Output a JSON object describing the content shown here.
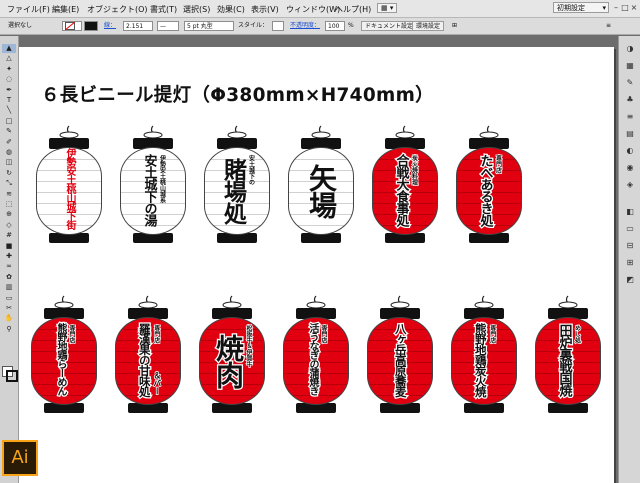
{
  "menubar": {
    "items": [
      "ファイル(F)",
      "編集(E)",
      "オブジェクト(O)",
      "書式(T)",
      "選択(S)",
      "効果(C)",
      "表示(V)",
      "ウィンドウ(W)",
      "ヘルプ(H)"
    ],
    "workspace": "初期設定"
  },
  "control_bar": {
    "selection": "選択なし",
    "stroke_label": "線：",
    "stroke_value": "2.151",
    "brush": "5 pt 丸型",
    "style_label": "スタイル：",
    "opacity_label": "不透明度：",
    "opacity_value": "100",
    "opacity_unit": "%",
    "document_setup": "ドキュメント設定",
    "preferences": "環境設定"
  },
  "tools": [
    "selection-tool",
    "direct-selection-tool",
    "magic-wand-tool",
    "lasso-tool",
    "pen-tool",
    "type-tool",
    "line-tool",
    "rectangle-tool",
    "paintbrush-tool",
    "pencil-tool",
    "blob-brush-tool",
    "eraser-tool",
    "rotate-tool",
    "scale-tool",
    "width-tool",
    "free-transform-tool",
    "shape-builder-tool",
    "perspective-tool",
    "mesh-tool",
    "gradient-tool",
    "eyedropper-tool",
    "blend-tool",
    "symbol-sprayer-tool",
    "graph-tool",
    "artboard-tool",
    "slice-tool",
    "hand-tool",
    "zoom-tool"
  ],
  "dock": [
    "color-icon",
    "swatches-icon",
    "brushes-icon",
    "symbols-icon",
    "stroke-icon",
    "gradient-icon",
    "transparency-icon",
    "appearance-icon",
    "graphic-styles-icon",
    "layers-icon",
    "artboards-icon",
    "align-icon",
    "transform-icon",
    "pathfinder-icon"
  ],
  "artboard": {
    "title": "６長ビニール提灯（Φ380mm×H740mm）",
    "lanterns_row1": [
      {
        "color": "white",
        "main": "伊勢安土桃山城下街",
        "main_color": "#e0000f",
        "sub": ""
      },
      {
        "color": "white",
        "main": "安土城下の湯",
        "sub": "伊勢安土桃山城系"
      },
      {
        "color": "white",
        "main": "賭場処",
        "sub": "安土城下の"
      },
      {
        "color": "white",
        "main": "矢場",
        "sub": ""
      },
      {
        "color": "red",
        "main": "合戦大食事処",
        "sub": "炭火焼料理"
      },
      {
        "color": "red",
        "main": "たべあるき処",
        "sub": "専門店"
      }
    ],
    "lanterns_row2": [
      {
        "color": "red",
        "main": "熊野地鶏らーめん",
        "sub": "専門店"
      },
      {
        "color": "red",
        "main": "羅漢果の甘味処",
        "sub": "専門店",
        "sub2": "＆バー"
      },
      {
        "color": "red",
        "main": "焼肉",
        "sub": "松阪牛＆伊賀牛"
      },
      {
        "color": "red",
        "main": "活うなぎの蒲焼き",
        "sub": "専門店"
      },
      {
        "color": "red",
        "main": "八ヶ岳高原蕎麦",
        "sub": ""
      },
      {
        "color": "red",
        "main": "熊野地鶏炭火焼",
        "sub": "専門店"
      },
      {
        "color": "red",
        "main": "田炉裏戦国焼",
        "sub": "めし処"
      }
    ]
  },
  "app_badge": "Ai",
  "colors": {
    "lantern_red": "#e0000f",
    "ai_orange": "#f7a417",
    "ai_bg": "#2a1b07"
  }
}
